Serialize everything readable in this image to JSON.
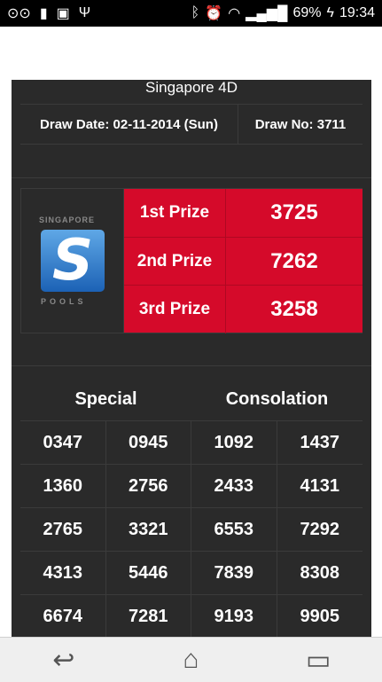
{
  "statusbar": {
    "icons_left": [
      "voicemail-icon",
      "sd-icon",
      "briefcase-icon",
      "usb-icon"
    ],
    "battery_pct": "69%",
    "time": "19:34"
  },
  "app": {
    "title": "Singapore 4D",
    "draw_date": "Draw Date: 02-11-2014 (Sun)",
    "draw_no": "Draw No: 3711"
  },
  "logo": {
    "top": "SINGAPORE",
    "letter": "S",
    "bottom": "POOLS"
  },
  "prizes": [
    {
      "label": "1st Prize",
      "number": "3725"
    },
    {
      "label": "2nd Prize",
      "number": "7262"
    },
    {
      "label": "3rd Prize",
      "number": "3258"
    }
  ],
  "headers": {
    "special": "Special",
    "consolation": "Consolation"
  },
  "rows": [
    [
      "0347",
      "0945",
      "1092",
      "1437"
    ],
    [
      "1360",
      "2756",
      "2433",
      "4131"
    ],
    [
      "2765",
      "3321",
      "6553",
      "7292"
    ],
    [
      "4313",
      "5446",
      "7839",
      "8308"
    ],
    [
      "6674",
      "7281",
      "9193",
      "9905"
    ]
  ],
  "colors": {
    "prize_red": "#d50a2a",
    "card_bg": "#2a2a2a"
  }
}
